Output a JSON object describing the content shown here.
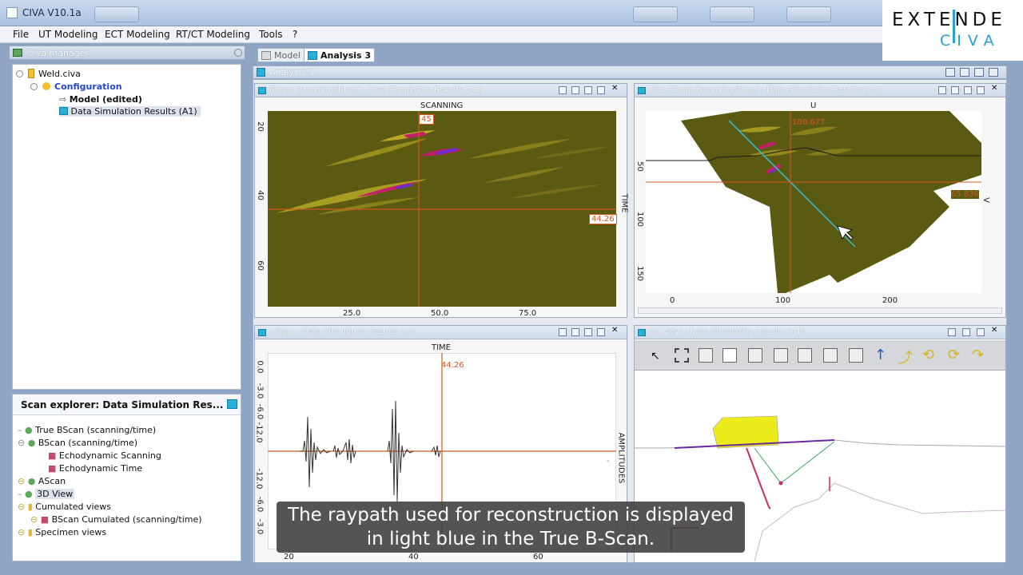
{
  "window": {
    "title": "CIVA V10.1a"
  },
  "logo": {
    "line1": "EXTENDE",
    "line2": "CIVA"
  },
  "menu": [
    "File",
    "UT Modeling",
    "ECT Modeling",
    "RT/CT Modeling",
    "Tools",
    "?"
  ],
  "civa_manager": {
    "title": "Civa manager",
    "tree": [
      "Weld.civa",
      "Configuration",
      "Model (edited)",
      "Data Simulation Results (A1)"
    ]
  },
  "scan_explorer": {
    "title": "Scan explorer: Data Simulation Res...",
    "items": [
      "True BScan (scanning/time)",
      "BScan (scanning/time)",
      "Echodynamic Scanning",
      "Echodynamic Time",
      "AScan",
      "3D View",
      "Cumulated views",
      "BScan Cumulated (scanning/time)",
      "Specimen views"
    ]
  },
  "tabs": [
    "Model",
    "Analysis 3"
  ],
  "analysis": {
    "title": "Analysis 3"
  },
  "bscan": {
    "title": "BScan (scanning/time) : Data Simulation Results (A1)",
    "top_label": "SCANNING",
    "right_label": "TIME",
    "cursor_x": "45",
    "cursor_y": "44.26",
    "x_ticks": [
      "25.0",
      "50.0",
      "75.0"
    ],
    "y_ticks": [
      "20",
      "40",
      "60"
    ]
  },
  "true_bscan": {
    "title": "True BScan (scanning/time) : Data Simulation Results (A1)",
    "top_label": "U",
    "right_label": "V",
    "cursor_x": "108.677",
    "cursor_y": "65.836",
    "x_ticks": [
      "0",
      "100",
      "200"
    ],
    "y_ticks": [
      "50",
      "100",
      "150"
    ]
  },
  "ascan": {
    "title": "AScan : Data Simulation Results (A1)",
    "top_label": "TIME",
    "right_label": "AMPLITUDES",
    "cursor_x": "44.26",
    "cursor_right": "-",
    "x_ticks": [
      "20",
      "40",
      "60"
    ],
    "y_ticks": [
      "0.0",
      "-3.0",
      "-6.0",
      "-12.0",
      "-12.0",
      "-6.0",
      "-3.0"
    ]
  },
  "view3d": {
    "title": "3D View : Data Simulation Results (A1)"
  },
  "subtitle": {
    "line1": "The raypath used for reconstruction is displayed",
    "line2": "in light blue in the True B-Scan."
  },
  "colors": {
    "plot_bg": "#5a5a12",
    "cursor": "#d2581e",
    "raypath": "#2fc4d6",
    "probe": "#ecec1c"
  }
}
